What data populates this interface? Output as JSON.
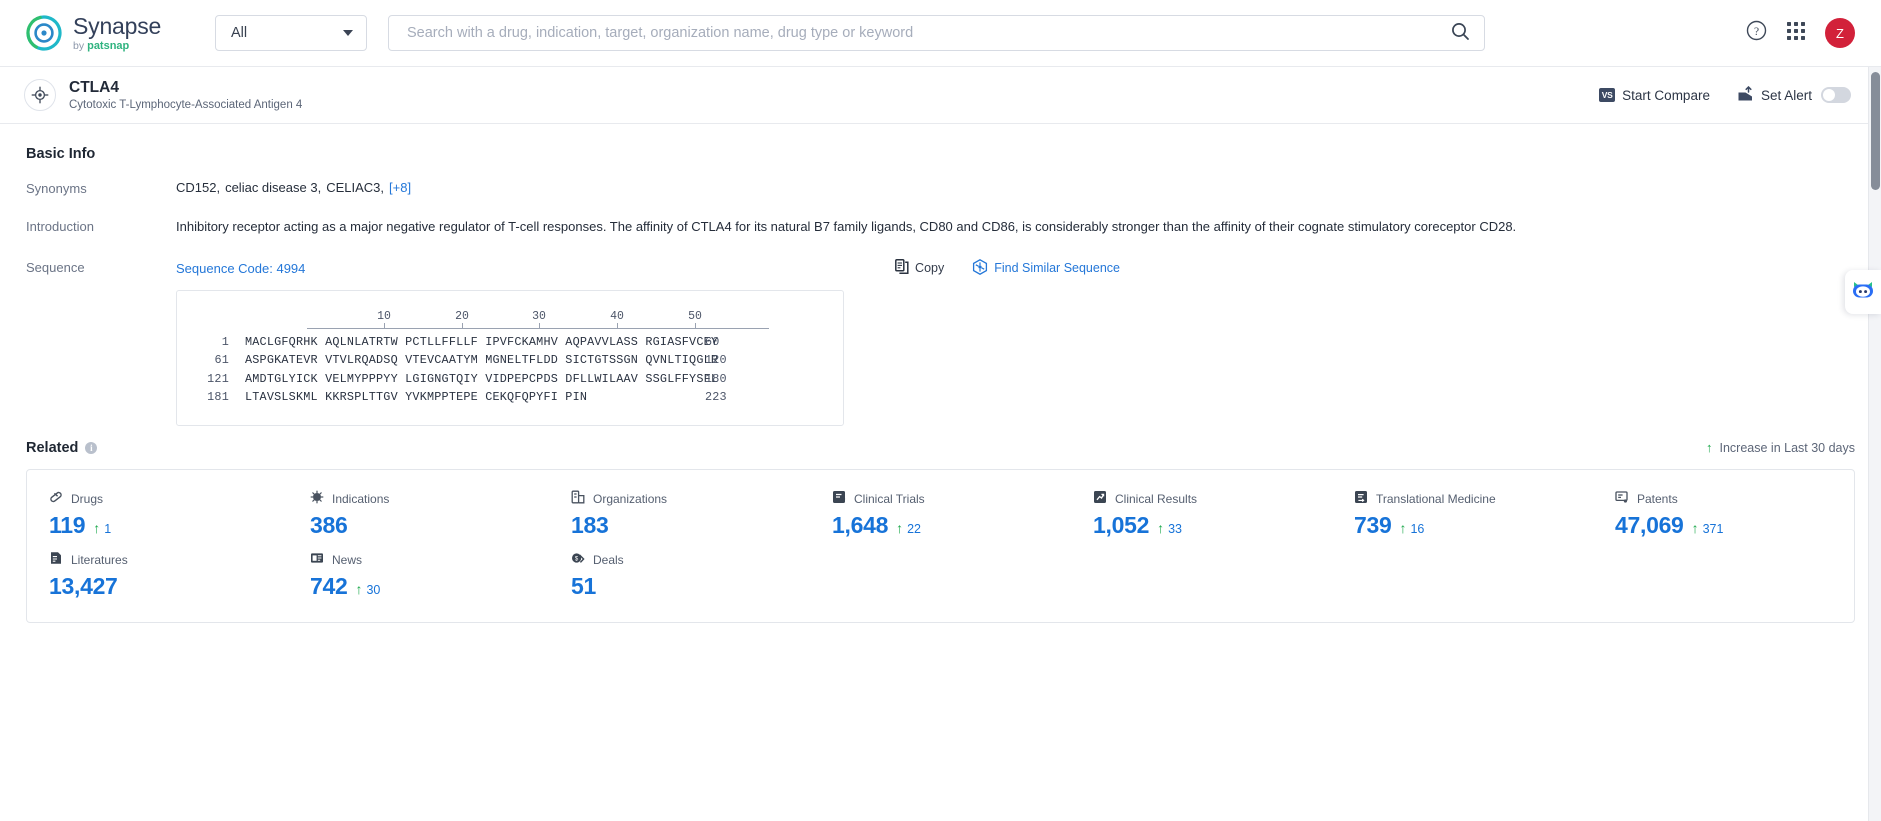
{
  "topbar": {
    "brand_name": "Synapse",
    "brand_sub_prefix": "by",
    "brand_sub_name": "patsnap",
    "scope_value": "All",
    "search_value": "",
    "search_placeholder": "Search with a drug, indication, target, organization name, drug type or keyword",
    "search_icon": "search-icon",
    "help_icon": "help-circle-icon",
    "apps_icon": "grid-apps-icon",
    "avatar_initial": "Z",
    "avatar_color": "#d2213a"
  },
  "subheader": {
    "entity_icon": "target-icon",
    "title": "CTLA4",
    "subtitle": "Cytotoxic T-Lymphocyte-Associated Antigen 4",
    "compare_badge": "VS",
    "compare_label": "Start Compare",
    "alert_icon": "alert-bell-icon",
    "alert_label": "Set Alert",
    "alert_toggle_on": false
  },
  "basic_info": {
    "heading": "Basic Info",
    "synonyms_label": "Synonyms",
    "synonyms": [
      "CD152,",
      "celiac disease 3,",
      "CELIAC3,"
    ],
    "synonyms_more": "[+8]",
    "introduction_label": "Introduction",
    "introduction": "Inhibitory receptor acting as a major negative regulator of T-cell responses. The affinity of CTLA4 for its natural B7 family ligands, CD80 and CD86, is considerably stronger than the affinity of their cognate stimulatory coreceptor CD28.",
    "sequence_label": "Sequence",
    "sequence_code": "Sequence Code: 4994",
    "copy_label": "Copy",
    "copy_icon": "copy-icon",
    "find_similar_label": "Find Similar Sequence",
    "find_similar_icon": "find-similar-icon",
    "sequence_ruler": [
      10,
      20,
      30,
      40,
      50
    ],
    "sequence_rows": [
      {
        "start": "1",
        "residues": "MACLGFQRHK AQLNLATRTW PCTLLFFLLF IPVFCKAMHV AQPAVVLASS RGIASFVCEY",
        "end": "60"
      },
      {
        "start": "61",
        "residues": "ASPGKATEVR VTVLRQADSQ VTEVCAATYM MGNELTFLDD SICTGTSSGN QVNLTIQGLR",
        "end": "120"
      },
      {
        "start": "121",
        "residues": "AMDTGLYICK VELMYPPPYY LGIGNGTQIY VIDPEPCPDS DFLLWILAAV SSGLFFYSFL",
        "end": "180"
      },
      {
        "start": "181",
        "residues": "LTAVSLSKML KKRSPLTTGV YVKMPPTEPE CEKQFQPYFI PIN",
        "end": "223"
      }
    ]
  },
  "related": {
    "heading": "Related",
    "info_icon": "info-icon",
    "legend": "Increase in Last 30 days",
    "legend_icon": "arrow-up-icon",
    "stats": [
      {
        "label": "Drugs",
        "icon": "capsule-icon",
        "value": "119",
        "delta": "1"
      },
      {
        "label": "Indications",
        "icon": "virus-icon",
        "value": "386",
        "delta": ""
      },
      {
        "label": "Organizations",
        "icon": "building-icon",
        "value": "183",
        "delta": ""
      },
      {
        "label": "Clinical Trials",
        "icon": "clinical-trial-icon",
        "value": "1,648",
        "delta": "22"
      },
      {
        "label": "Clinical Results",
        "icon": "results-chart-icon",
        "value": "1,052",
        "delta": "33"
      },
      {
        "label": "Translational Medicine",
        "icon": "translational-icon",
        "value": "739",
        "delta": "16"
      },
      {
        "label": "Patents",
        "icon": "patent-icon",
        "value": "47,069",
        "delta": "371"
      },
      {
        "label": "Literatures",
        "icon": "literature-icon",
        "value": "13,427",
        "delta": ""
      },
      {
        "label": "News",
        "icon": "news-icon",
        "value": "742",
        "delta": "30"
      },
      {
        "label": "Deals",
        "icon": "deals-icon",
        "value": "51",
        "delta": ""
      }
    ]
  },
  "chat_fab": {
    "icon": "robot-assistant-icon"
  }
}
